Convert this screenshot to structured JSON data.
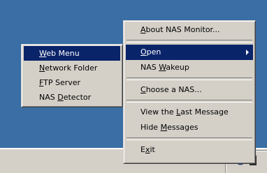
{
  "colors": {
    "desktop": "#3a6ea5",
    "menu_bg": "#d4d0c8",
    "highlight": "#0a246a"
  },
  "context_menu": {
    "items": [
      {
        "pre": "",
        "key": "A",
        "post": "bout NAS Monitor..."
      },
      {
        "pre": "",
        "key": "O",
        "post": "pen"
      },
      {
        "pre": "NAS ",
        "key": "W",
        "post": "akeup"
      },
      {
        "pre": "",
        "key": "C",
        "post": "hoose a NAS..."
      },
      {
        "pre": "View the ",
        "key": "L",
        "post": "ast Message"
      },
      {
        "pre": "Hide ",
        "key": "M",
        "post": "essages"
      },
      {
        "pre": "E",
        "key": "x",
        "post": "it"
      }
    ]
  },
  "open_submenu": {
    "items": [
      {
        "pre": "",
        "key": "W",
        "post": "eb Menu"
      },
      {
        "pre": "",
        "key": "N",
        "post": "etwork Folder"
      },
      {
        "pre": "",
        "key": "F",
        "post": "TP Server"
      },
      {
        "pre": "NAS ",
        "key": "D",
        "post": "etector"
      }
    ]
  },
  "tray": {
    "icons": [
      "shield-icon",
      "nas-monitor-icon"
    ]
  }
}
